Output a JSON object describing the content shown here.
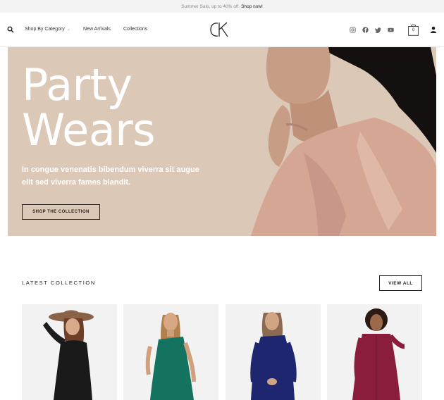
{
  "announcement": {
    "text": "Summer Sale, up to 40% off.",
    "link": "Shop now!"
  },
  "nav": {
    "items": [
      "Shop By Category",
      "New Arrivals",
      "Collections"
    ]
  },
  "brand": {
    "logo": "CK"
  },
  "social_icons": [
    "instagram-icon",
    "facebook-icon",
    "twitter-icon",
    "youtube-icon"
  ],
  "cart": {
    "count": "0"
  },
  "hero": {
    "title_line1": "Party",
    "title_line2": "Wears",
    "subtitle": "In congue venenatis bibendum viverra sit augue elit sed viverra fames blandit.",
    "button": "SHOP THE COLLECTION",
    "bg_color": "#dcc8b6"
  },
  "latest": {
    "title": "LATEST COLLECTION",
    "view_all": "VIEW ALL"
  },
  "products": [
    {
      "image": "model in black outfit with brown hat"
    },
    {
      "image": "model in green sequin one-shoulder dress"
    },
    {
      "image": "model in navy lace dress"
    },
    {
      "image": "model in burgundy shirt dress"
    }
  ]
}
